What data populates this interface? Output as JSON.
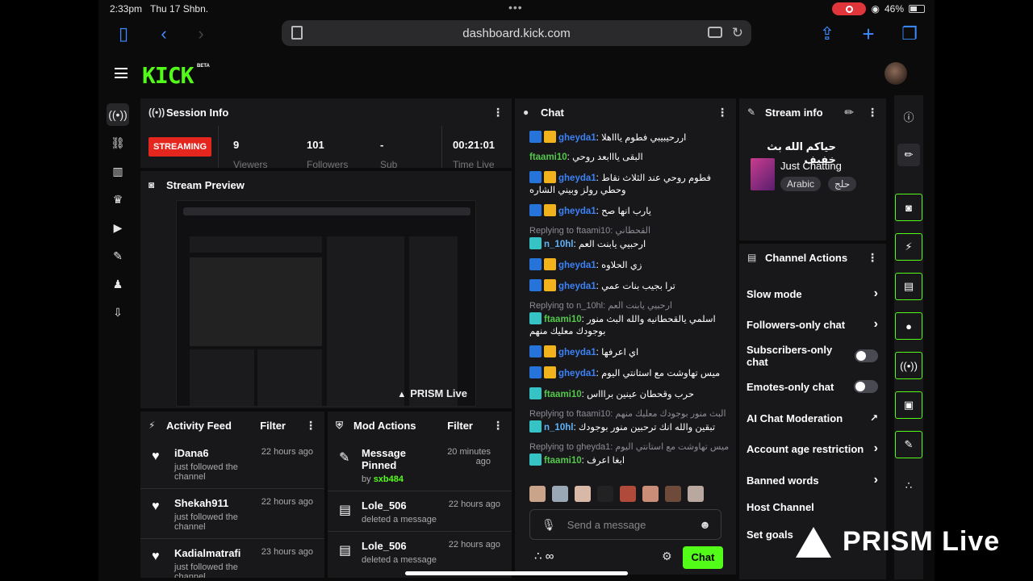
{
  "status": {
    "time": "2:33pm",
    "date": "Thu 17 Shbn.",
    "battery": "46%"
  },
  "browser": {
    "url": "dashboard.kick.com"
  },
  "app": {
    "logo": "KICK",
    "beta": "BETA"
  },
  "session": {
    "title": "Session Info",
    "state": "STREAMING",
    "stats": [
      {
        "value": "9",
        "label": "Viewers"
      },
      {
        "value": "101",
        "label": "Followers"
      },
      {
        "value": "-",
        "label": "Sub"
      },
      {
        "value": "00:21:01",
        "label": "Time Live"
      }
    ]
  },
  "preview": {
    "title": "Stream Preview",
    "watermark": "PRISM Live"
  },
  "activity": {
    "title": "Activity Feed",
    "filter": "Filter",
    "items": [
      {
        "name": "iDana6",
        "time": "22 hours ago",
        "text": "just followed the channel"
      },
      {
        "name": "Shekah911",
        "time": "22 hours ago",
        "text": "just followed the channel"
      },
      {
        "name": "Kadialmatrafi",
        "time": "23 hours ago",
        "text": "just followed the channel"
      }
    ]
  },
  "mod": {
    "title": "Mod Actions",
    "filter": "Filter",
    "items": [
      {
        "title": "Message Pinned",
        "by": "by",
        "user": "sxb484",
        "time": "20 minutes ago"
      },
      {
        "title": "Lole_506",
        "sub": "deleted a message",
        "time": "22 hours ago"
      },
      {
        "title": "Lole_506",
        "sub": "deleted a message",
        "time": "22 hours ago"
      }
    ]
  },
  "chat": {
    "title": "Chat",
    "messages": [
      {
        "user": "gheyda1",
        "color": "#3b82f6",
        "badges": [
          "mod",
          "crown"
        ],
        "text": "اررحيبيبي فطوم ياااهلا"
      },
      {
        "user": "ftaami10",
        "color": "#53c84a",
        "badges": [],
        "text": "البقى يااابعد روحي"
      },
      {
        "user": "gheyda1",
        "color": "#3b82f6",
        "badges": [
          "mod",
          "crown"
        ],
        "text": "فطوم روحي عند الثلاث نقاط وحطي رولز وبيني الشاره"
      },
      {
        "user": "gheyda1",
        "color": "#3b82f6",
        "badges": [
          "mod",
          "crown"
        ],
        "text": "يارب انها صح"
      },
      {
        "reply": "Replying to ftaami10: القحطاني",
        "user": "n_10hl",
        "color": "#5eb3f7",
        "badges": [
          "vip"
        ],
        "text": "ارحبيي يابنت العم"
      },
      {
        "user": "gheyda1",
        "color": "#3b82f6",
        "badges": [
          "mod",
          "crown"
        ],
        "text": "زي الحلاوه"
      },
      {
        "user": "gheyda1",
        "color": "#3b82f6",
        "badges": [
          "mod",
          "crown"
        ],
        "text": "ترا بجيب بنات عمي"
      },
      {
        "reply": "Replying to n_10hl: ارحبيي يابنت العم",
        "user": "ftaami10",
        "color": "#53c84a",
        "badges": [
          "vip"
        ],
        "text": "اسلمي يالقحطانيه والله البث منور بوجودك معليك منهم"
      },
      {
        "user": "gheyda1",
        "color": "#3b82f6",
        "badges": [
          "mod",
          "crown"
        ],
        "text": "اي اعرفها"
      },
      {
        "user": "gheyda1",
        "color": "#3b82f6",
        "badges": [
          "mod",
          "crown"
        ],
        "text": "ميس تهاوشت مع استانتي اليوم"
      },
      {
        "user": "ftaami10",
        "color": "#53c84a",
        "badges": [
          "vip"
        ],
        "text": "حرب وقحطان عينين براااس"
      },
      {
        "reply": "Replying to ftaami10: البث منور بوجودك معليك منهم",
        "user": "n_10hl",
        "color": "#5eb3f7",
        "badges": [
          "vip"
        ],
        "text": "تبقين والله انك ترحبين منور بوجودك"
      },
      {
        "reply": "Replying to gheyda1: ميس تهاوشت مع استانتي اليوم",
        "user": "ftaami10",
        "color": "#53c84a",
        "badges": [
          "vip"
        ],
        "text": "ابغا اعرف"
      }
    ],
    "placeholder": "Send a message",
    "send_label": "Chat"
  },
  "stream_info": {
    "title": "Stream info",
    "stream_title": "حياكم الله بث خفيف",
    "category": "Just Chatting",
    "tags": [
      "Arabic",
      "حلج"
    ]
  },
  "channel_actions": {
    "title": "Channel Actions",
    "items": [
      {
        "label": "Slow mode",
        "control": "arrow"
      },
      {
        "label": "Followers-only chat",
        "control": "arrow"
      },
      {
        "label": "Subscribers-only chat",
        "control": "toggle"
      },
      {
        "label": "Emotes-only chat",
        "control": "toggle"
      },
      {
        "label": "AI Chat Moderation",
        "control": "external"
      },
      {
        "label": "Account age restriction",
        "control": "arrow"
      },
      {
        "label": "Banned words",
        "control": "arrow"
      },
      {
        "label": "Host Channel",
        "control": "none"
      },
      {
        "label": "Set goals",
        "control": "none"
      }
    ]
  },
  "watermark": "PRISM Live"
}
